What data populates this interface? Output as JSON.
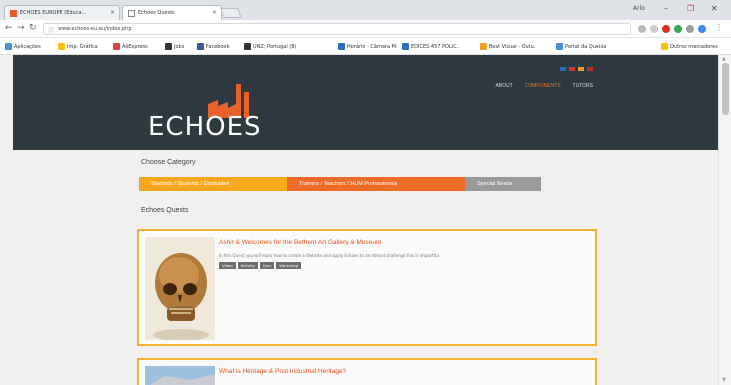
{
  "browser": {
    "tabs": [
      {
        "title": "ECHOES EUROPE (Educa..."
      },
      {
        "title": "Echoes Quests"
      }
    ],
    "user_name": "Arlo",
    "url": "www.echoes-eu.eu/index.php",
    "bookmarks": [
      {
        "label": "Aplicações",
        "color": "#4a90d9"
      },
      {
        "label": "Imp. Gráfica",
        "color": "#f4c20d"
      },
      {
        "label": "AliExpress",
        "color": "#e04040"
      },
      {
        "label": "Jobs",
        "color": "#333333"
      },
      {
        "label": "Facebook",
        "color": "#3b5998"
      },
      {
        "label": "UNZ, Portugal (8)",
        "color": "#333333"
      },
      {
        "label": "Horário - Câmara M.",
        "color": "#2a6ebb"
      },
      {
        "label": "EDICES 457 POLIC.",
        "color": "#2a6ebb"
      },
      {
        "label": "Best Visual - Outu.",
        "color": "#f0a020"
      },
      {
        "label": "Portal da Queixa",
        "color": "#4a90d9"
      },
      {
        "label": "Outros marcadores",
        "color": "#f4c20d"
      }
    ]
  },
  "site": {
    "logo_text": "ECHOES",
    "nav": [
      {
        "label": "ABOUT",
        "active": false
      },
      {
        "label": "COMPONENTS",
        "active": true
      },
      {
        "label": "TUTORS",
        "active": false
      }
    ],
    "choose_category": "Choose Category",
    "categories": [
      {
        "label": "Students / Students / Graduates",
        "color": "#f7a81c"
      },
      {
        "label": "Trainers / Teachers / HUM Professionals",
        "color": "#ee6b28"
      },
      {
        "label": "Special Needs",
        "color": "#9a9a9a"
      }
    ],
    "quests_title": "Echoes Quests",
    "quests": [
      {
        "title": "Ashir & Welcomes for the Bethem Art Gallery & Museum",
        "description": "In this Quest you will learn how to create a Website and apply Echoes to an ethical challenge this is impactful.",
        "tags": [
          "Video",
          "Activity",
          "Quiz",
          "Workshop"
        ]
      },
      {
        "title": "What is Heritage & Post Industrial Heritage?",
        "description": "",
        "tags": []
      }
    ]
  }
}
